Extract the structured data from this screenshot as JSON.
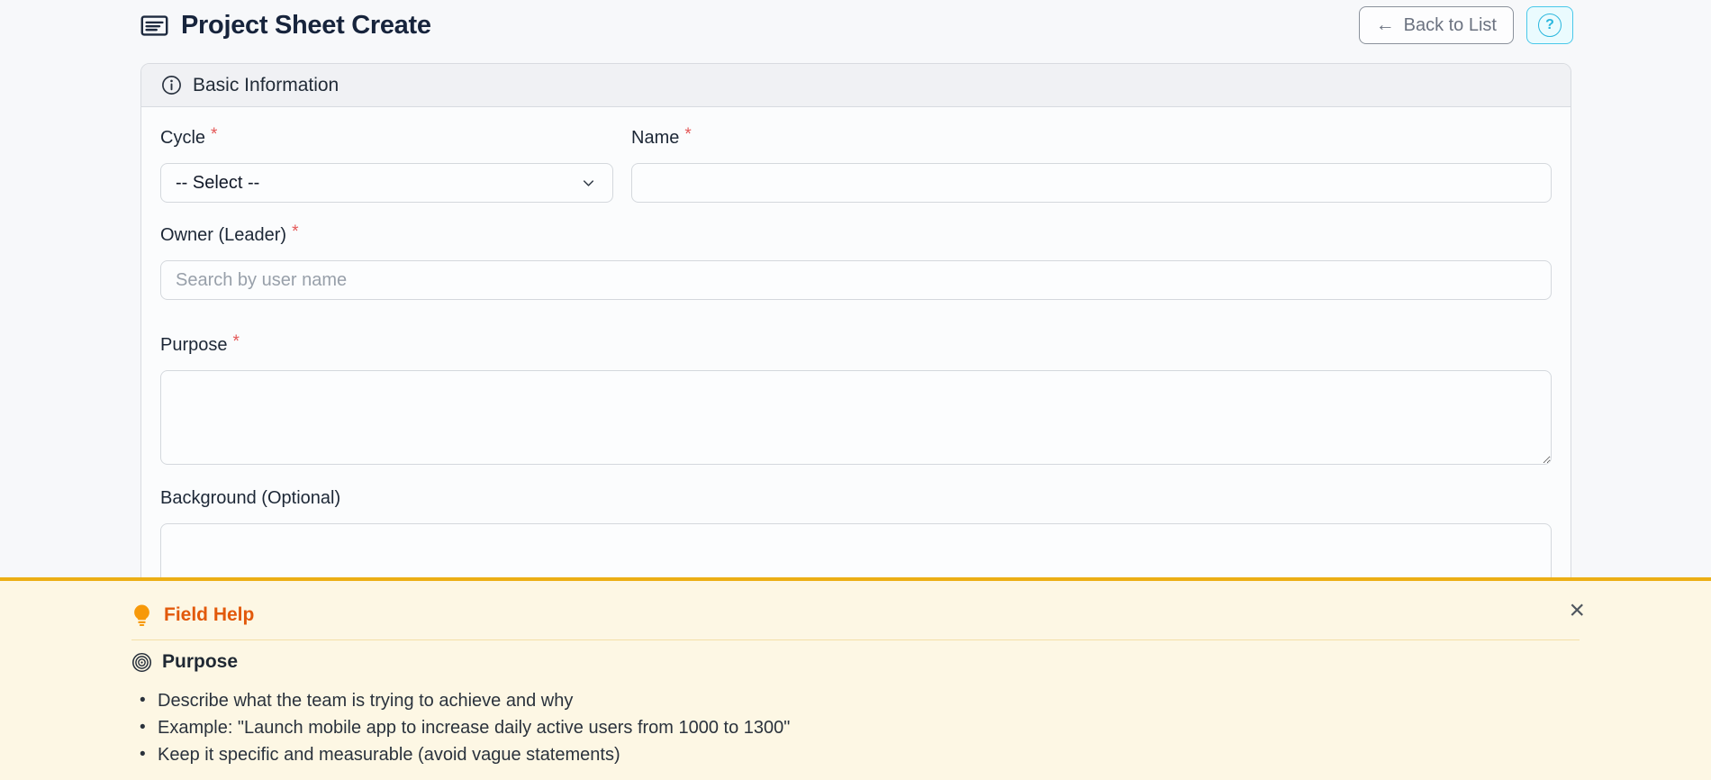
{
  "colors": {
    "page_bg": "#f7f8fa",
    "card_bg": "#fbfcfd",
    "card_header_bg": "#f0f1f4",
    "accent_gold": "#ecae14",
    "help_bg": "#fdf7e4",
    "help_title_orange": "#e2590b",
    "bulb_orange": "#f79909",
    "cyan_border": "#49c8ea",
    "cyan_bg": "#eafbfe",
    "required_red": "#e45858",
    "title_navy": "#17243c"
  },
  "header": {
    "title": "Project Sheet Create",
    "back_arrow": "←",
    "back_label": "Back to List"
  },
  "form": {
    "section_title": "Basic Information",
    "fields": {
      "cycle": {
        "label": "Cycle",
        "required_mark": "*",
        "value": "-- Select --"
      },
      "name": {
        "label": "Name",
        "required_mark": "*",
        "value": ""
      },
      "owner": {
        "label": "Owner (Leader)",
        "required_mark": "*",
        "placeholder": "Search by user name",
        "value": ""
      },
      "purpose": {
        "label": "Purpose",
        "required_mark": "*",
        "value": ""
      },
      "background": {
        "label": "Background (Optional)",
        "value": ""
      }
    }
  },
  "help_panel": {
    "title": "Field Help",
    "close_glyph": "×",
    "section": {
      "title": "Purpose",
      "bullets": [
        "Describe what the team is trying to achieve and why",
        "Example: \"Launch mobile app to increase daily active users from 1000 to 1300\"",
        "Keep it specific and measurable (avoid vague statements)"
      ]
    }
  }
}
